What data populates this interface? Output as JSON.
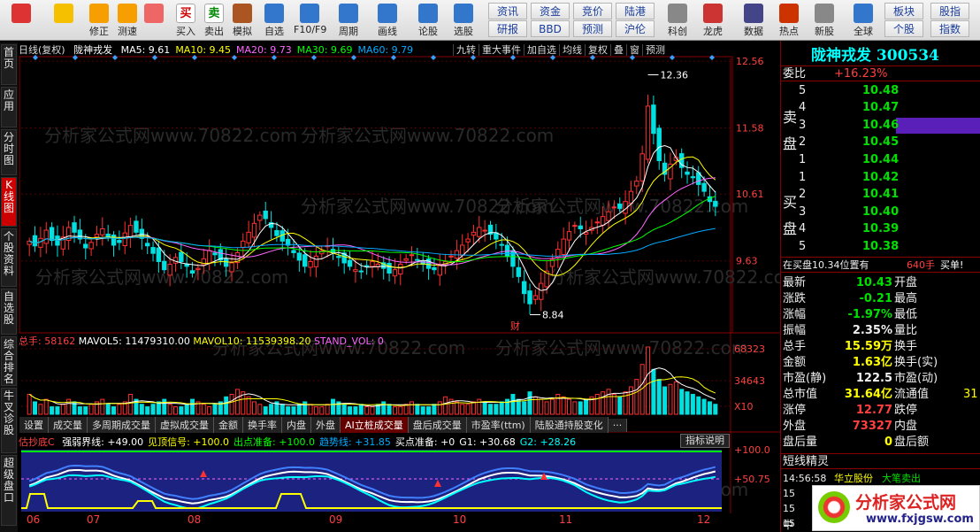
{
  "toolbar": {
    "buttons": [
      {
        "label": "",
        "icon": "windows-grid-icon"
      },
      {
        "label": "",
        "icon": "back-arrow-icon"
      },
      {
        "label": "修正",
        "icon": "up-down-arrow-icon"
      },
      {
        "label": "测速",
        "icon": "power-icon"
      },
      {
        "label": "",
        "icon": "clock-icon"
      },
      {
        "label": "买入",
        "icon": "buy-icon",
        "text": "买"
      },
      {
        "label": "卖出",
        "icon": "sell-icon",
        "text": "卖"
      },
      {
        "label": "模拟",
        "icon": "hammer-icon"
      },
      {
        "label": "自选",
        "icon": "star-icon"
      },
      {
        "label": "F10/F9",
        "icon": "f10-icon"
      },
      {
        "label": "周期",
        "icon": "period-icon"
      },
      {
        "label": "画线",
        "icon": "pencil-icon"
      },
      {
        "label": "论股",
        "icon": "discuss-icon"
      },
      {
        "label": "选股",
        "icon": "select-stock-icon"
      },
      {
        "label": "科创",
        "icon": "tech-icon"
      },
      {
        "label": "龙虎",
        "icon": "dragon-icon"
      },
      {
        "label": "数据",
        "icon": "pe-icon"
      },
      {
        "label": "热点",
        "icon": "hot-icon"
      },
      {
        "label": "新股",
        "icon": "ipo-icon"
      },
      {
        "label": "全球",
        "icon": "globe-icon"
      }
    ],
    "small_buttons": [
      "资讯",
      "资金",
      "竞价",
      "陆港",
      "研报",
      "BBD",
      "预测",
      "沪伦",
      "板块",
      "股指",
      "个股",
      "指数"
    ]
  },
  "side_tabs": [
    "首页",
    "应用",
    "分时图",
    "K线图",
    "个股资料",
    "自选股",
    "综合排名",
    "牛叉诊股",
    "超级盘口"
  ],
  "chart_header": {
    "name": "日线(复权)",
    "stock": "陇神戎发",
    "ma": [
      {
        "text": "MA5: 9.61",
        "color": "#ffffff"
      },
      {
        "text": "MA10: 9.45",
        "color": "#ffff00"
      },
      {
        "text": "MA20: 9.73",
        "color": "#ff66ff"
      },
      {
        "text": "MA30: 9.69",
        "color": "#00ff00"
      },
      {
        "text": "MA60: 9.79",
        "color": "#00aaff"
      }
    ],
    "buttons": [
      "九转",
      "重大事件",
      "加自选",
      "均线",
      "复权",
      "叠",
      "窗",
      "预测"
    ]
  },
  "price_axis": [
    "12.56",
    "11.58",
    "10.61",
    "9.63"
  ],
  "high_label": "12.36",
  "low_label": "8.84",
  "fin_marker": "财",
  "volume_header": {
    "total": "总手: 58162",
    "mavol5": "MAVOL5: 11479310.00",
    "mavol10": "MAVOL10: 11539398.20",
    "stand": "STAND_VOL: 0"
  },
  "volume_axis": [
    "68323",
    "34643",
    "X10"
  ],
  "tabs": [
    "设置",
    "成交量",
    "多周期成交量",
    "虚拟成交量",
    "金额",
    "换手率",
    "内盘",
    "外盘",
    "AI立桩成交量",
    "盘后成交量",
    "市盈率(ttm)",
    "陆股通持股变化",
    "···"
  ],
  "indicator_header": {
    "name": "估抄底C",
    "items": [
      {
        "text": "强弱界线: +49.00",
        "color": "#ffffff"
      },
      {
        "text": "见顶信号: +100.0",
        "color": "#ffff00"
      },
      {
        "text": "出点准备: +100.0",
        "color": "#00ff00"
      },
      {
        "text": "趋势线: +31.85",
        "color": "#00aaff"
      },
      {
        "text": "买点准备: +0",
        "color": "#ffffff"
      },
      {
        "text": "G1: +30.68",
        "color": "#ffffff"
      },
      {
        "text": "G2: +28.26",
        "color": "#00ffff"
      }
    ],
    "help": "指标说明"
  },
  "indicator_axis": [
    "+100.0",
    "+50.75"
  ],
  "date_axis": [
    "06",
    "07",
    "08",
    "09",
    "10",
    "11",
    "12"
  ],
  "watermark": "分析家公式网www.70822.com",
  "right_panel": {
    "title": "陇神戎发 300534",
    "weibi_label": "委比",
    "weibi_value": "+16.23%",
    "sell_label": "卖盘",
    "buy_label": "买盘",
    "asks": [
      {
        "level": "5",
        "price": "10.48"
      },
      {
        "level": "4",
        "price": "10.47"
      },
      {
        "level": "3",
        "price": "10.46"
      },
      {
        "level": "2",
        "price": "10.45"
      },
      {
        "level": "1",
        "price": "10.44"
      }
    ],
    "bids": [
      {
        "level": "1",
        "price": "10.42"
      },
      {
        "level": "2",
        "price": "10.41"
      },
      {
        "level": "3",
        "price": "10.40"
      },
      {
        "level": "4",
        "price": "10.39"
      },
      {
        "level": "5",
        "price": "10.38"
      }
    ],
    "position_line": "在买盘10.34位置有",
    "position_vol": "640手",
    "position_action": "买单!",
    "stats": [
      {
        "l": "最新",
        "v": "10.43",
        "vc": "green",
        "r": "开盘"
      },
      {
        "l": "涨跌",
        "v": "-0.21",
        "vc": "green",
        "r": "最高"
      },
      {
        "l": "涨幅",
        "v": "-1.97%",
        "vc": "green",
        "r": "最低"
      },
      {
        "l": "振幅",
        "v": "2.35%",
        "vc": "white",
        "r": "量比"
      },
      {
        "l": "总手",
        "v": "15.59万",
        "vc": "yellow",
        "r": "换手"
      },
      {
        "l": "金额",
        "v": "1.63亿",
        "vc": "yellow",
        "r": "换手(实)"
      },
      {
        "l": "市盈(静)",
        "v": "122.5",
        "vc": "white",
        "r": "市盈(动)"
      },
      {
        "l": "总市值",
        "v": "31.64亿",
        "vc": "yellow",
        "r": "流通值",
        "r2": "31"
      },
      {
        "l": "涨停",
        "v": "12.77",
        "vc": "red",
        "r": "跌停"
      },
      {
        "l": "外盘",
        "v": "73327",
        "vc": "red",
        "r": "内盘"
      },
      {
        "l": "盘后量",
        "v": "0",
        "vc": "yellow",
        "r": "盘后额"
      }
    ],
    "short_title": "短线精灵",
    "short_rows": [
      {
        "time": "14:56:58",
        "name": "华立股份",
        "action": "大笔卖出"
      },
      {
        "time": "15",
        "name": "",
        "action": ""
      },
      {
        "time": "15",
        "name": "",
        "action": ""
      },
      {
        "time": "15",
        "name": "",
        "action": ""
      }
    ],
    "bottom_char": "中"
  },
  "logo": {
    "cn": "分析家公式网",
    "url": "www.fxjgsw.com"
  },
  "chart_data": {
    "type": "candlestick",
    "title": "陇神戎发 日线(复权)",
    "ylim": [
      8.6,
      12.6
    ],
    "x_months": [
      "06",
      "07",
      "08",
      "09",
      "10",
      "11",
      "12"
    ],
    "closes": [
      9.92,
      9.85,
      9.96,
      10.08,
      9.93,
      9.86,
      9.98,
      10.12,
      10.05,
      9.95,
      9.82,
      9.9,
      10.02,
      10.1,
      9.98,
      9.86,
      9.9,
      10.04,
      10.15,
      10.05,
      9.96,
      9.85,
      9.74,
      9.62,
      9.5,
      9.58,
      9.68,
      9.62,
      9.55,
      9.45,
      9.52,
      9.66,
      9.78,
      9.72,
      9.64,
      9.55,
      9.6,
      9.75,
      9.92,
      10.05,
      10.18,
      10.3,
      10.25,
      10.12,
      10.0,
      9.92,
      9.86,
      9.75,
      9.64,
      9.55,
      9.62,
      9.7,
      9.78,
      9.85,
      9.75,
      9.68,
      9.6,
      9.55,
      9.5,
      9.48,
      9.55,
      9.62,
      9.58,
      9.52,
      9.45,
      9.5,
      9.58,
      9.66,
      9.72,
      9.65,
      9.58,
      9.52,
      9.5,
      9.56,
      9.62,
      9.7,
      9.78,
      9.86,
      9.95,
      10.05,
      10.12,
      10.08,
      10.02,
      9.95,
      9.86,
      9.7,
      9.55,
      9.4,
      9.15,
      9.0,
      9.12,
      9.3,
      9.48,
      9.65,
      9.8,
      9.95,
      10.06,
      10.15,
      10.1,
      10.05,
      10.12,
      10.2,
      10.28,
      10.35,
      10.42,
      10.4,
      10.5,
      10.65,
      10.8,
      11.2,
      11.9,
      11.5,
      11.1,
      10.9,
      11.05,
      11.15,
      11.0,
      10.9,
      10.85,
      10.75,
      10.65,
      10.5,
      10.43
    ],
    "volumes": [
      8,
      5,
      4,
      6,
      3,
      3,
      4,
      6,
      5,
      3,
      3,
      4,
      5,
      6,
      4,
      3,
      4,
      5,
      8,
      6,
      4,
      3,
      4,
      5,
      6,
      4,
      3,
      3,
      4,
      6,
      5,
      4,
      3,
      4,
      5,
      7,
      8,
      10,
      9,
      7,
      5,
      4,
      3,
      4,
      5,
      4,
      3,
      3,
      4,
      5,
      4,
      3,
      3,
      4,
      6,
      5,
      4,
      3,
      3,
      4,
      3,
      3,
      4,
      5,
      4,
      3,
      3,
      4,
      5,
      4,
      3,
      3,
      4,
      5,
      7,
      6,
      5,
      4,
      4,
      5,
      6,
      5,
      4,
      4,
      5,
      6,
      8,
      6,
      5,
      9,
      7,
      6,
      5,
      6,
      8,
      7,
      6,
      5,
      5,
      6,
      7,
      8,
      9,
      10,
      8,
      7,
      9,
      11,
      14,
      20,
      27,
      18,
      14,
      11,
      12,
      13,
      10,
      9,
      8,
      7,
      6,
      5,
      4
    ],
    "high": 12.36,
    "low": 8.84
  }
}
